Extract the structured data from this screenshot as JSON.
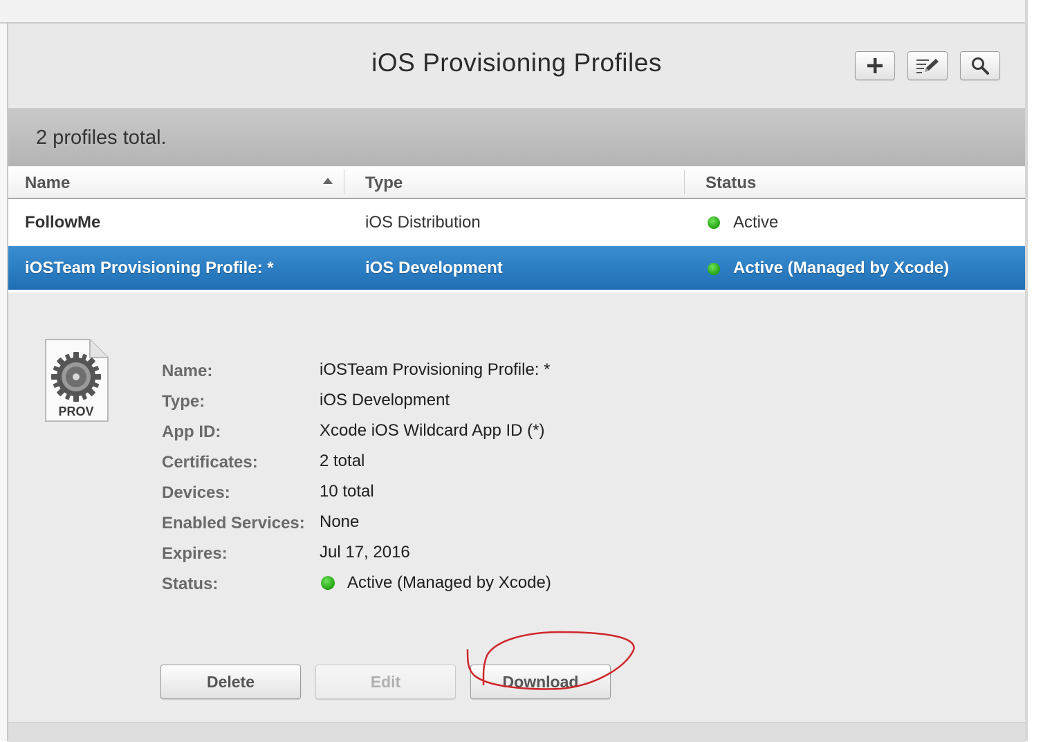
{
  "header": {
    "title": "iOS Provisioning Profiles",
    "tools": [
      {
        "name": "add",
        "icon": "plus-icon"
      },
      {
        "name": "edit",
        "icon": "edit-list-icon"
      },
      {
        "name": "search",
        "icon": "search-icon"
      }
    ]
  },
  "summary": {
    "text": "2 profiles total."
  },
  "table": {
    "columns": [
      "Name",
      "Type",
      "Status"
    ],
    "sort": {
      "column": "Name",
      "direction": "ascending"
    },
    "rows": [
      {
        "name": "FollowMe",
        "type": "iOS Distribution",
        "status": "Active",
        "status_color": "#28a416",
        "selected": false
      },
      {
        "name": "iOSTeam Provisioning Profile: *",
        "type": "iOS Development",
        "status": "Active (Managed by Xcode)",
        "status_color": "#28a416",
        "selected": true
      }
    ]
  },
  "details": {
    "icon": {
      "name": "prov-file-icon",
      "label": "PROV"
    },
    "fields": [
      {
        "label": "Name:",
        "value": "iOSTeam Provisioning Profile: *"
      },
      {
        "label": "Type:",
        "value": "iOS Development"
      },
      {
        "label": "App ID:",
        "value": "Xcode iOS Wildcard App ID (*)"
      },
      {
        "label": "Certificates:",
        "value": "2 total"
      },
      {
        "label": "Devices:",
        "value": "10 total"
      },
      {
        "label": "Enabled Services:",
        "value": "None"
      },
      {
        "label": "Expires:",
        "value": "Jul 17, 2016"
      },
      {
        "label": "Status:",
        "value": "Active (Managed by Xcode)"
      }
    ]
  },
  "actions": {
    "delete_label": "Delete",
    "edit_label": "Edit",
    "download_label": "Download"
  },
  "colors": {
    "selection": "#2a7dc4",
    "status_active": "#28a416",
    "annotation": "#d0262a"
  }
}
